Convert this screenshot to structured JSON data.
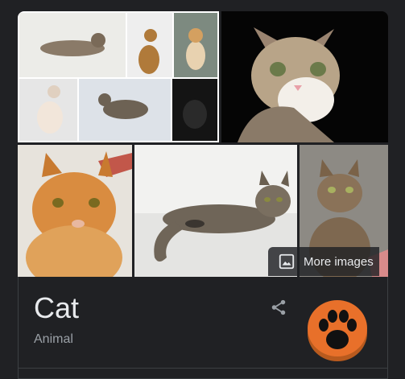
{
  "gallery": {
    "more_images_label": "More images",
    "images": [
      "cat-collage",
      "cat-closeup",
      "orange-cat",
      "tabby-lying",
      "tabby-sitting"
    ]
  },
  "entity": {
    "title": "Cat",
    "subtitle": "Animal"
  },
  "icons": {
    "share": "share-icon",
    "more_images": "image-icon",
    "thumb": "paw-icon"
  },
  "colors": {
    "background": "#202124",
    "title": "#e8eaed",
    "subtitle": "#9aa0a6",
    "thumb_orange": "#e8702a"
  }
}
